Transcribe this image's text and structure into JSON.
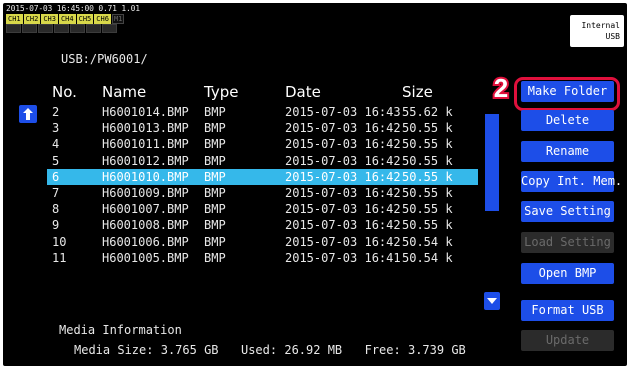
{
  "status": {
    "datetime_line": "2015-07-03 16:45:00 0.71 1.01",
    "channels_on": [
      "CH1",
      "CH2",
      "CH3",
      "CH4",
      "CH5",
      "CH6"
    ],
    "channel_off": "M1"
  },
  "storage": {
    "line1": "Internal",
    "line2": "USB"
  },
  "path": "USB:/PW6001/",
  "table": {
    "headers": {
      "no": "No.",
      "name": "Name",
      "type": "Type",
      "date": "Date",
      "size": "Size"
    },
    "rows": [
      {
        "no": "2",
        "name": "H6001014.BMP",
        "type": "BMP",
        "date": "2015-07-03 16:43",
        "size": "55.62 k"
      },
      {
        "no": "3",
        "name": "H6001013.BMP",
        "type": "BMP",
        "date": "2015-07-03 16:42",
        "size": "50.55 k"
      },
      {
        "no": "4",
        "name": "H6001011.BMP",
        "type": "BMP",
        "date": "2015-07-03 16:42",
        "size": "50.55 k"
      },
      {
        "no": "5",
        "name": "H6001012.BMP",
        "type": "BMP",
        "date": "2015-07-03 16:42",
        "size": "50.55 k"
      },
      {
        "no": "6",
        "name": "H6001010.BMP",
        "type": "BMP",
        "date": "2015-07-03 16:42",
        "size": "50.55 k",
        "selected": true
      },
      {
        "no": "7",
        "name": "H6001009.BMP",
        "type": "BMP",
        "date": "2015-07-03 16:42",
        "size": "50.55 k"
      },
      {
        "no": "8",
        "name": "H6001007.BMP",
        "type": "BMP",
        "date": "2015-07-03 16:42",
        "size": "50.55 k"
      },
      {
        "no": "9",
        "name": "H6001008.BMP",
        "type": "BMP",
        "date": "2015-07-03 16:42",
        "size": "50.55 k"
      },
      {
        "no": "10",
        "name": "H6001006.BMP",
        "type": "BMP",
        "date": "2015-07-03 16:42",
        "size": "50.54 k"
      },
      {
        "no": "11",
        "name": "H6001005.BMP",
        "type": "BMP",
        "date": "2015-07-03 16:41",
        "size": "50.54 k"
      }
    ]
  },
  "media": {
    "title": "Media Information",
    "size_label": "Media Size:",
    "size_value": "3.765 GB",
    "used_label": "Used:",
    "used_value": "26.92 MB",
    "free_label": "Free:",
    "free_value": "3.739 GB"
  },
  "buttons": {
    "make_folder": "Make Folder",
    "delete": "Delete",
    "rename": "Rename",
    "copy_int": "Copy Int. Mem.",
    "save_setting": "Save Setting",
    "load_setting": "Load Setting",
    "open_bmp": "Open BMP",
    "format_usb": "Format USB",
    "update": "Update"
  },
  "step_marker": "2",
  "colors": {
    "button_blue": "#1d4ee8",
    "selected_row": "#35b8ea",
    "highlight_red": "#e0103c",
    "disabled_gray": "#2b2b2b"
  },
  "icons": {
    "up": "arrow-up-icon",
    "down": "triangle-down-icon"
  }
}
